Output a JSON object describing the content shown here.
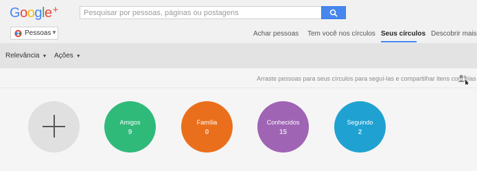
{
  "header": {
    "logo_text": "Google",
    "logo_plus": "+",
    "logo_colors": [
      "#4285f4",
      "#ea4335",
      "#fbbc05",
      "#4285f4",
      "#34a853",
      "#ea4335"
    ],
    "plus_color": "#dd4b39",
    "search": {
      "placeholder": "Pesquisar por pessoas, páginas ou postagens",
      "button_icon": "search-icon"
    }
  },
  "nav": {
    "app_switcher_label": "Pessoas",
    "tabs": [
      {
        "label": "Achar pessoas",
        "active": false
      },
      {
        "label": "Tem você nos círculos",
        "active": false
      },
      {
        "label": "Seus círculos",
        "active": true
      },
      {
        "label": "Descobrir mais",
        "active": false
      }
    ],
    "active_underline_color": "#4285f4"
  },
  "filters": {
    "sort_label": "Relevância",
    "actions_label": "Ações"
  },
  "hint": {
    "text": "Arraste pessoas para seus círculos para seguí-las e compartilhar itens com elas",
    "icon": "people-icon"
  },
  "circles": [
    {
      "name": "Amigos",
      "count": "9",
      "color": "#2fba7a"
    },
    {
      "name": "Família",
      "count": "0",
      "color": "#ea6f1c"
    },
    {
      "name": "Conhecidos",
      "count": "15",
      "color": "#a064b4"
    },
    {
      "name": "Seguindo",
      "count": "2",
      "color": "#1fa2d2"
    }
  ],
  "add_circle_icon": "plus-icon"
}
